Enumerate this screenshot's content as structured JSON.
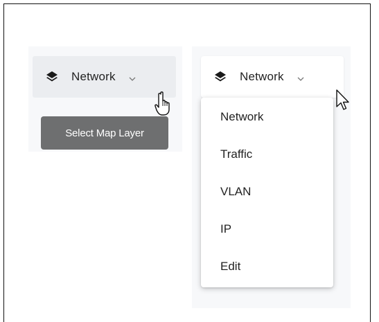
{
  "left_control": {
    "button_label": "Network",
    "icon": "layers-icon",
    "tooltip": "Select Map Layer"
  },
  "right_control": {
    "button_label": "Network",
    "icon": "layers-icon",
    "menu_items": [
      "Network",
      "Traffic",
      "VLAN",
      "IP",
      "Edit"
    ]
  },
  "colors": {
    "tooltip_bg": "#6e6f70",
    "hover_bg": "#ebedf0",
    "panel_bg": "#f7f8fa"
  }
}
